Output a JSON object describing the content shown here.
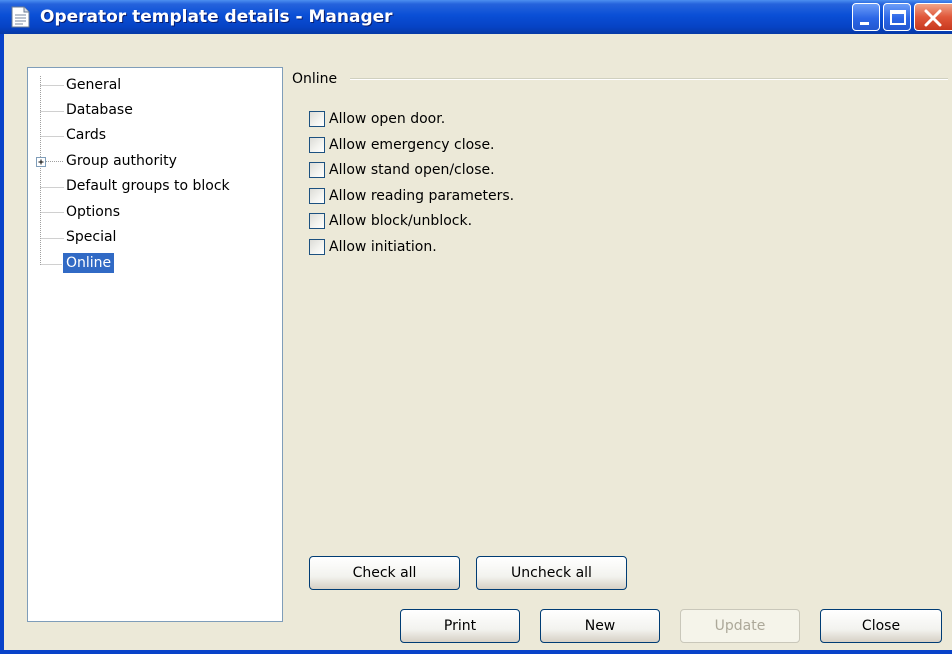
{
  "window": {
    "title": "Operator template details - Manager",
    "icons": {
      "app": "document-icon",
      "minimize": "minimize-icon",
      "maximize": "maximize-icon",
      "close": "close-icon"
    }
  },
  "tree": {
    "items": [
      {
        "label": "General",
        "expandable": false,
        "selected": false
      },
      {
        "label": "Database",
        "expandable": false,
        "selected": false
      },
      {
        "label": "Cards",
        "expandable": false,
        "selected": false
      },
      {
        "label": "Group authority",
        "expandable": true,
        "selected": false
      },
      {
        "label": "Default groups to block",
        "expandable": false,
        "selected": false
      },
      {
        "label": "Options",
        "expandable": false,
        "selected": false
      },
      {
        "label": "Special",
        "expandable": false,
        "selected": false
      },
      {
        "label": "Online",
        "expandable": false,
        "selected": true
      }
    ]
  },
  "online": {
    "group_label": "Online",
    "checkboxes": [
      {
        "label": "Allow open door.",
        "checked": false
      },
      {
        "label": "Allow emergency close.",
        "checked": false
      },
      {
        "label": "Allow stand open/close.",
        "checked": false
      },
      {
        "label": "Allow reading parameters.",
        "checked": false
      },
      {
        "label": "Allow block/unblock.",
        "checked": false
      },
      {
        "label": "Allow initiation.",
        "checked": false
      }
    ],
    "check_all": "Check all",
    "uncheck_all": "Uncheck all"
  },
  "footer": {
    "print": "Print",
    "new": "New",
    "update": "Update",
    "update_enabled": false,
    "close": "Close"
  },
  "colors": {
    "title_bar": "#0a4fd6",
    "selection": "#316ac5",
    "window_bg": "#ece9d8"
  }
}
